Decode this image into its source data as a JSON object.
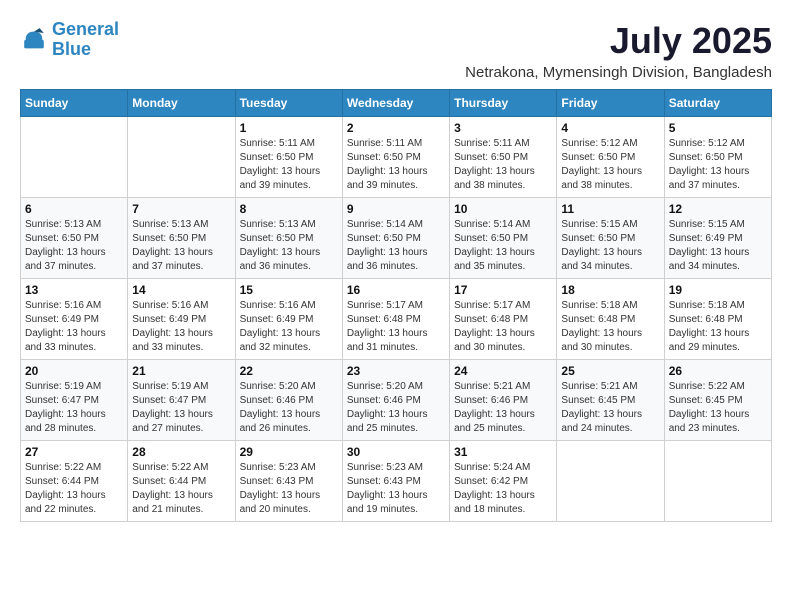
{
  "logo": {
    "line1": "General",
    "line2": "Blue"
  },
  "title": "July 2025",
  "location": "Netrakona, Mymensingh Division, Bangladesh",
  "weekdays": [
    "Sunday",
    "Monday",
    "Tuesday",
    "Wednesday",
    "Thursday",
    "Friday",
    "Saturday"
  ],
  "weeks": [
    [
      {
        "day": "",
        "info": ""
      },
      {
        "day": "",
        "info": ""
      },
      {
        "day": "1",
        "info": "Sunrise: 5:11 AM\nSunset: 6:50 PM\nDaylight: 13 hours\nand 39 minutes."
      },
      {
        "day": "2",
        "info": "Sunrise: 5:11 AM\nSunset: 6:50 PM\nDaylight: 13 hours\nand 39 minutes."
      },
      {
        "day": "3",
        "info": "Sunrise: 5:11 AM\nSunset: 6:50 PM\nDaylight: 13 hours\nand 38 minutes."
      },
      {
        "day": "4",
        "info": "Sunrise: 5:12 AM\nSunset: 6:50 PM\nDaylight: 13 hours\nand 38 minutes."
      },
      {
        "day": "5",
        "info": "Sunrise: 5:12 AM\nSunset: 6:50 PM\nDaylight: 13 hours\nand 37 minutes."
      }
    ],
    [
      {
        "day": "6",
        "info": "Sunrise: 5:13 AM\nSunset: 6:50 PM\nDaylight: 13 hours\nand 37 minutes."
      },
      {
        "day": "7",
        "info": "Sunrise: 5:13 AM\nSunset: 6:50 PM\nDaylight: 13 hours\nand 37 minutes."
      },
      {
        "day": "8",
        "info": "Sunrise: 5:13 AM\nSunset: 6:50 PM\nDaylight: 13 hours\nand 36 minutes."
      },
      {
        "day": "9",
        "info": "Sunrise: 5:14 AM\nSunset: 6:50 PM\nDaylight: 13 hours\nand 36 minutes."
      },
      {
        "day": "10",
        "info": "Sunrise: 5:14 AM\nSunset: 6:50 PM\nDaylight: 13 hours\nand 35 minutes."
      },
      {
        "day": "11",
        "info": "Sunrise: 5:15 AM\nSunset: 6:50 PM\nDaylight: 13 hours\nand 34 minutes."
      },
      {
        "day": "12",
        "info": "Sunrise: 5:15 AM\nSunset: 6:49 PM\nDaylight: 13 hours\nand 34 minutes."
      }
    ],
    [
      {
        "day": "13",
        "info": "Sunrise: 5:16 AM\nSunset: 6:49 PM\nDaylight: 13 hours\nand 33 minutes."
      },
      {
        "day": "14",
        "info": "Sunrise: 5:16 AM\nSunset: 6:49 PM\nDaylight: 13 hours\nand 33 minutes."
      },
      {
        "day": "15",
        "info": "Sunrise: 5:16 AM\nSunset: 6:49 PM\nDaylight: 13 hours\nand 32 minutes."
      },
      {
        "day": "16",
        "info": "Sunrise: 5:17 AM\nSunset: 6:48 PM\nDaylight: 13 hours\nand 31 minutes."
      },
      {
        "day": "17",
        "info": "Sunrise: 5:17 AM\nSunset: 6:48 PM\nDaylight: 13 hours\nand 30 minutes."
      },
      {
        "day": "18",
        "info": "Sunrise: 5:18 AM\nSunset: 6:48 PM\nDaylight: 13 hours\nand 30 minutes."
      },
      {
        "day": "19",
        "info": "Sunrise: 5:18 AM\nSunset: 6:48 PM\nDaylight: 13 hours\nand 29 minutes."
      }
    ],
    [
      {
        "day": "20",
        "info": "Sunrise: 5:19 AM\nSunset: 6:47 PM\nDaylight: 13 hours\nand 28 minutes."
      },
      {
        "day": "21",
        "info": "Sunrise: 5:19 AM\nSunset: 6:47 PM\nDaylight: 13 hours\nand 27 minutes."
      },
      {
        "day": "22",
        "info": "Sunrise: 5:20 AM\nSunset: 6:46 PM\nDaylight: 13 hours\nand 26 minutes."
      },
      {
        "day": "23",
        "info": "Sunrise: 5:20 AM\nSunset: 6:46 PM\nDaylight: 13 hours\nand 25 minutes."
      },
      {
        "day": "24",
        "info": "Sunrise: 5:21 AM\nSunset: 6:46 PM\nDaylight: 13 hours\nand 25 minutes."
      },
      {
        "day": "25",
        "info": "Sunrise: 5:21 AM\nSunset: 6:45 PM\nDaylight: 13 hours\nand 24 minutes."
      },
      {
        "day": "26",
        "info": "Sunrise: 5:22 AM\nSunset: 6:45 PM\nDaylight: 13 hours\nand 23 minutes."
      }
    ],
    [
      {
        "day": "27",
        "info": "Sunrise: 5:22 AM\nSunset: 6:44 PM\nDaylight: 13 hours\nand 22 minutes."
      },
      {
        "day": "28",
        "info": "Sunrise: 5:22 AM\nSunset: 6:44 PM\nDaylight: 13 hours\nand 21 minutes."
      },
      {
        "day": "29",
        "info": "Sunrise: 5:23 AM\nSunset: 6:43 PM\nDaylight: 13 hours\nand 20 minutes."
      },
      {
        "day": "30",
        "info": "Sunrise: 5:23 AM\nSunset: 6:43 PM\nDaylight: 13 hours\nand 19 minutes."
      },
      {
        "day": "31",
        "info": "Sunrise: 5:24 AM\nSunset: 6:42 PM\nDaylight: 13 hours\nand 18 minutes."
      },
      {
        "day": "",
        "info": ""
      },
      {
        "day": "",
        "info": ""
      }
    ]
  ]
}
